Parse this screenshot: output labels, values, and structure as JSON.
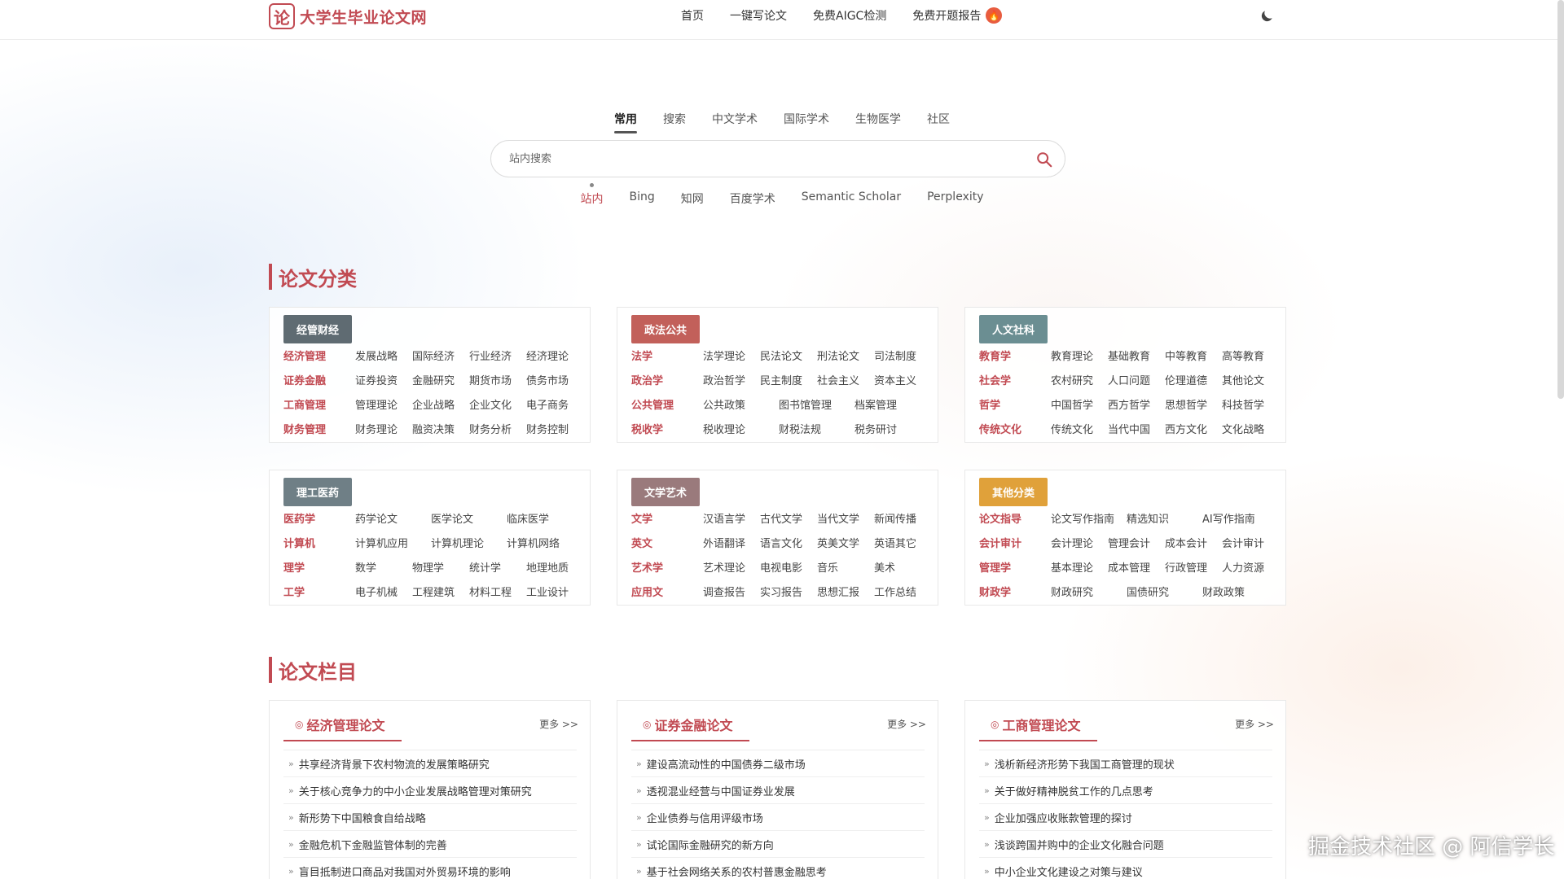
{
  "header": {
    "logo_char": "论",
    "logo_text": "大学生毕业论文网",
    "nav": [
      "首页",
      "一键写论文",
      "免费AIGC检测",
      "免费开题报告"
    ],
    "hot_badge": "🔥"
  },
  "search": {
    "tabs": [
      "常用",
      "搜索",
      "中文学术",
      "国际学术",
      "生物医学",
      "社区"
    ],
    "placeholder": "站内搜索",
    "engines": [
      "站内",
      "Bing",
      "知网",
      "百度学术",
      "Semantic Scholar",
      "Perplexity"
    ]
  },
  "categories": {
    "title": "论文分类",
    "cards": [
      {
        "tag": "经管财经",
        "color": "#5f6b72",
        "rows": [
          {
            "head": "经济管理",
            "links": [
              "发展战略",
              "国际经济",
              "行业经济",
              "经济理论"
            ]
          },
          {
            "head": "证券金融",
            "links": [
              "证券投资",
              "金融研究",
              "期货市场",
              "债务市场"
            ]
          },
          {
            "head": "工商管理",
            "links": [
              "管理理论",
              "企业战略",
              "企业文化",
              "电子商务"
            ]
          },
          {
            "head": "财务管理",
            "links": [
              "财务理论",
              "融资决策",
              "财务分析",
              "财务控制"
            ]
          }
        ]
      },
      {
        "tag": "政法公共",
        "color": "#c2605a",
        "rows": [
          {
            "head": "法学",
            "links": [
              "法学理论",
              "民法论文",
              "刑法论文",
              "司法制度"
            ]
          },
          {
            "head": "政治学",
            "links": [
              "政治哲学",
              "民主制度",
              "社会主义",
              "资本主义"
            ]
          },
          {
            "head": "公共管理",
            "links": [
              "公共政策",
              "图书馆管理",
              "档案管理"
            ]
          },
          {
            "head": "税收学",
            "links": [
              "税收理论",
              "财税法规",
              "税务研讨"
            ]
          }
        ]
      },
      {
        "tag": "人文社科",
        "color": "#6b8e92",
        "rows": [
          {
            "head": "教育学",
            "links": [
              "教育理论",
              "基础教育",
              "中等教育",
              "高等教育"
            ]
          },
          {
            "head": "社会学",
            "links": [
              "农村研究",
              "人口问题",
              "伦理道德",
              "其他论文"
            ]
          },
          {
            "head": "哲学",
            "links": [
              "中国哲学",
              "西方哲学",
              "思想哲学",
              "科技哲学"
            ]
          },
          {
            "head": "传统文化",
            "links": [
              "传统文化",
              "当代中国",
              "西方文化",
              "文化战略"
            ]
          }
        ]
      },
      {
        "tag": "理工医药",
        "color": "#6f7f86",
        "rows": [
          {
            "head": "医药学",
            "links": [
              "药学论文",
              "医学论文",
              "临床医学"
            ]
          },
          {
            "head": "计算机",
            "links": [
              "计算机应用",
              "计算机理论",
              "计算机网络"
            ]
          },
          {
            "head": "理学",
            "links": [
              "数学",
              "物理学",
              "统计学",
              "地理地质"
            ]
          },
          {
            "head": "工学",
            "links": [
              "电子机械",
              "工程建筑",
              "材料工程",
              "工业设计"
            ]
          }
        ]
      },
      {
        "tag": "文学艺术",
        "color": "#9a7a7c",
        "rows": [
          {
            "head": "文学",
            "links": [
              "汉语言学",
              "古代文学",
              "当代文学",
              "新闻传播"
            ]
          },
          {
            "head": "英文",
            "links": [
              "外语翻译",
              "语言文化",
              "英美文学",
              "英语其它"
            ]
          },
          {
            "head": "艺术学",
            "links": [
              "艺术理论",
              "电视电影",
              "音乐",
              "美术"
            ]
          },
          {
            "head": "应用文",
            "links": [
              "调查报告",
              "实习报告",
              "思想汇报",
              "工作总结"
            ]
          }
        ]
      },
      {
        "tag": "其他分类",
        "color": "#e0a13a",
        "rows": [
          {
            "head": "论文指导",
            "links": [
              "论文写作指南",
              "精选知识",
              "AI写作指南"
            ]
          },
          {
            "head": "会计审计",
            "links": [
              "会计理论",
              "管理会计",
              "成本会计",
              "会计审计"
            ]
          },
          {
            "head": "管理学",
            "links": [
              "基本理论",
              "成本管理",
              "行政管理",
              "人力资源"
            ]
          },
          {
            "head": "财政学",
            "links": [
              "财政研究",
              "国债研究",
              "财政政策"
            ]
          }
        ]
      }
    ]
  },
  "columns": {
    "title": "论文栏目",
    "more": "更多 >>",
    "cards": [
      {
        "title": "经济管理论文",
        "items": [
          "共享经济背景下农村物流的发展策略研究",
          "关于核心竞争力的中小企业发展战略管理对策研究",
          "新形势下中国粮食自给战略",
          "金融危机下金融监管体制的完善",
          "盲目抵制进口商品对我国对外贸易环境的影响"
        ]
      },
      {
        "title": "证券金融论文",
        "items": [
          "建设高流动性的中国债券二级市场",
          "透视混业经营与中国证券业发展",
          "企业债券与信用评级市场",
          "试论国际金融研究的新方向",
          "基于社会网络关系的农村普惠金融思考"
        ]
      },
      {
        "title": "工商管理论文",
        "items": [
          "浅析新经济形势下我国工商管理的现状",
          "关于做好精神脱贫工作的几点思考",
          "企业加强应收账款管理的探讨",
          "浅谈跨国并购中的企业文化融合问题",
          "中小企业文化建设之对策与建议"
        ]
      }
    ]
  },
  "watermark": "掘金技术社区 @ 阿信学长",
  "theme": {
    "accent": "#c14a52"
  }
}
